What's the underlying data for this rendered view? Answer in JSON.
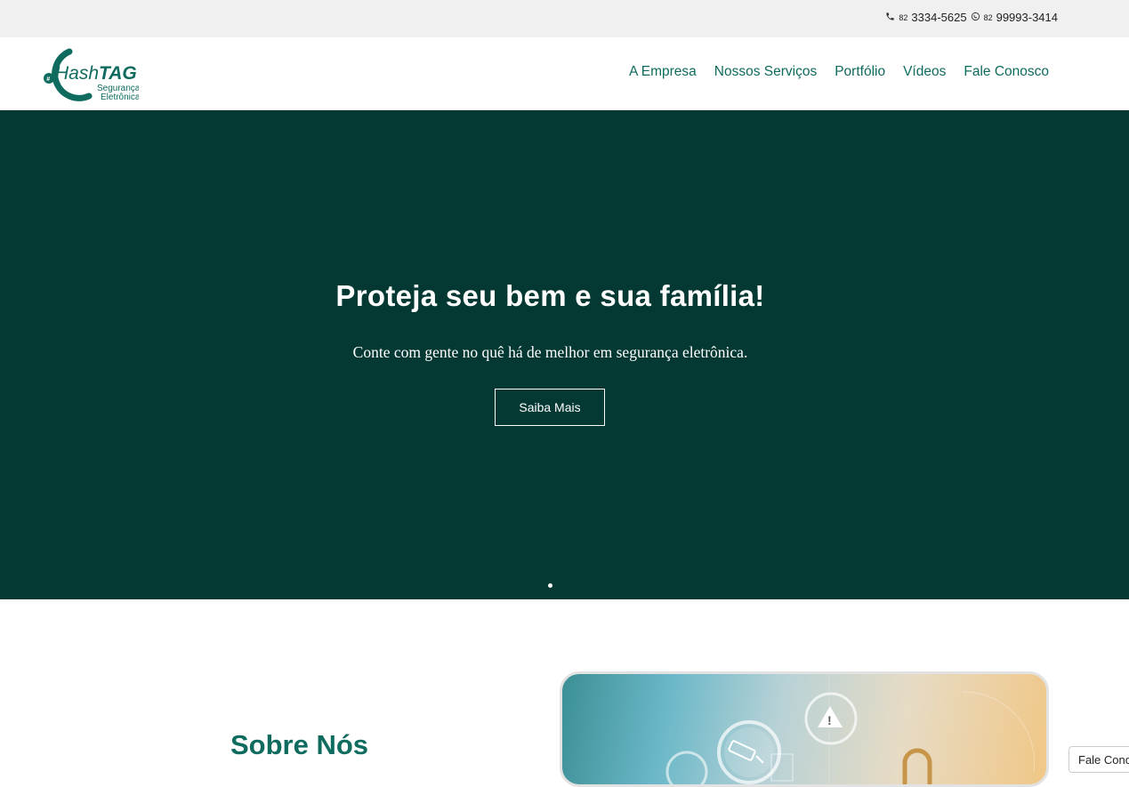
{
  "topbar": {
    "phone_ddd": "82",
    "phone_number": "3334-5625",
    "whatsapp_ddd": "82",
    "whatsapp_number": "99993-3414",
    "phone_icon": "phone-icon",
    "whatsapp_icon": "whatsapp-icon"
  },
  "header": {
    "logo": {
      "brand_hash": "Hash",
      "brand_tag": "TAG",
      "line1": "Segurança",
      "line2": "Eletrônica"
    },
    "nav": [
      "A Empresa",
      "Nossos Serviços",
      "Portfólio",
      "Vídeos",
      "Fale Conosco"
    ]
  },
  "hero": {
    "title": "Proteja seu bem e sua família!",
    "subtitle": "Conte com gente no quê há de melhor em segurança eletrônica.",
    "button": "Saiba Mais",
    "background": "#043833"
  },
  "about": {
    "title": "Sobre Nós"
  },
  "chat_widget": {
    "label": "Fale Conosco"
  },
  "colors": {
    "accent": "#0e6b5e",
    "topbar_bg": "#f0f0f0",
    "hero_bg": "#043833"
  }
}
